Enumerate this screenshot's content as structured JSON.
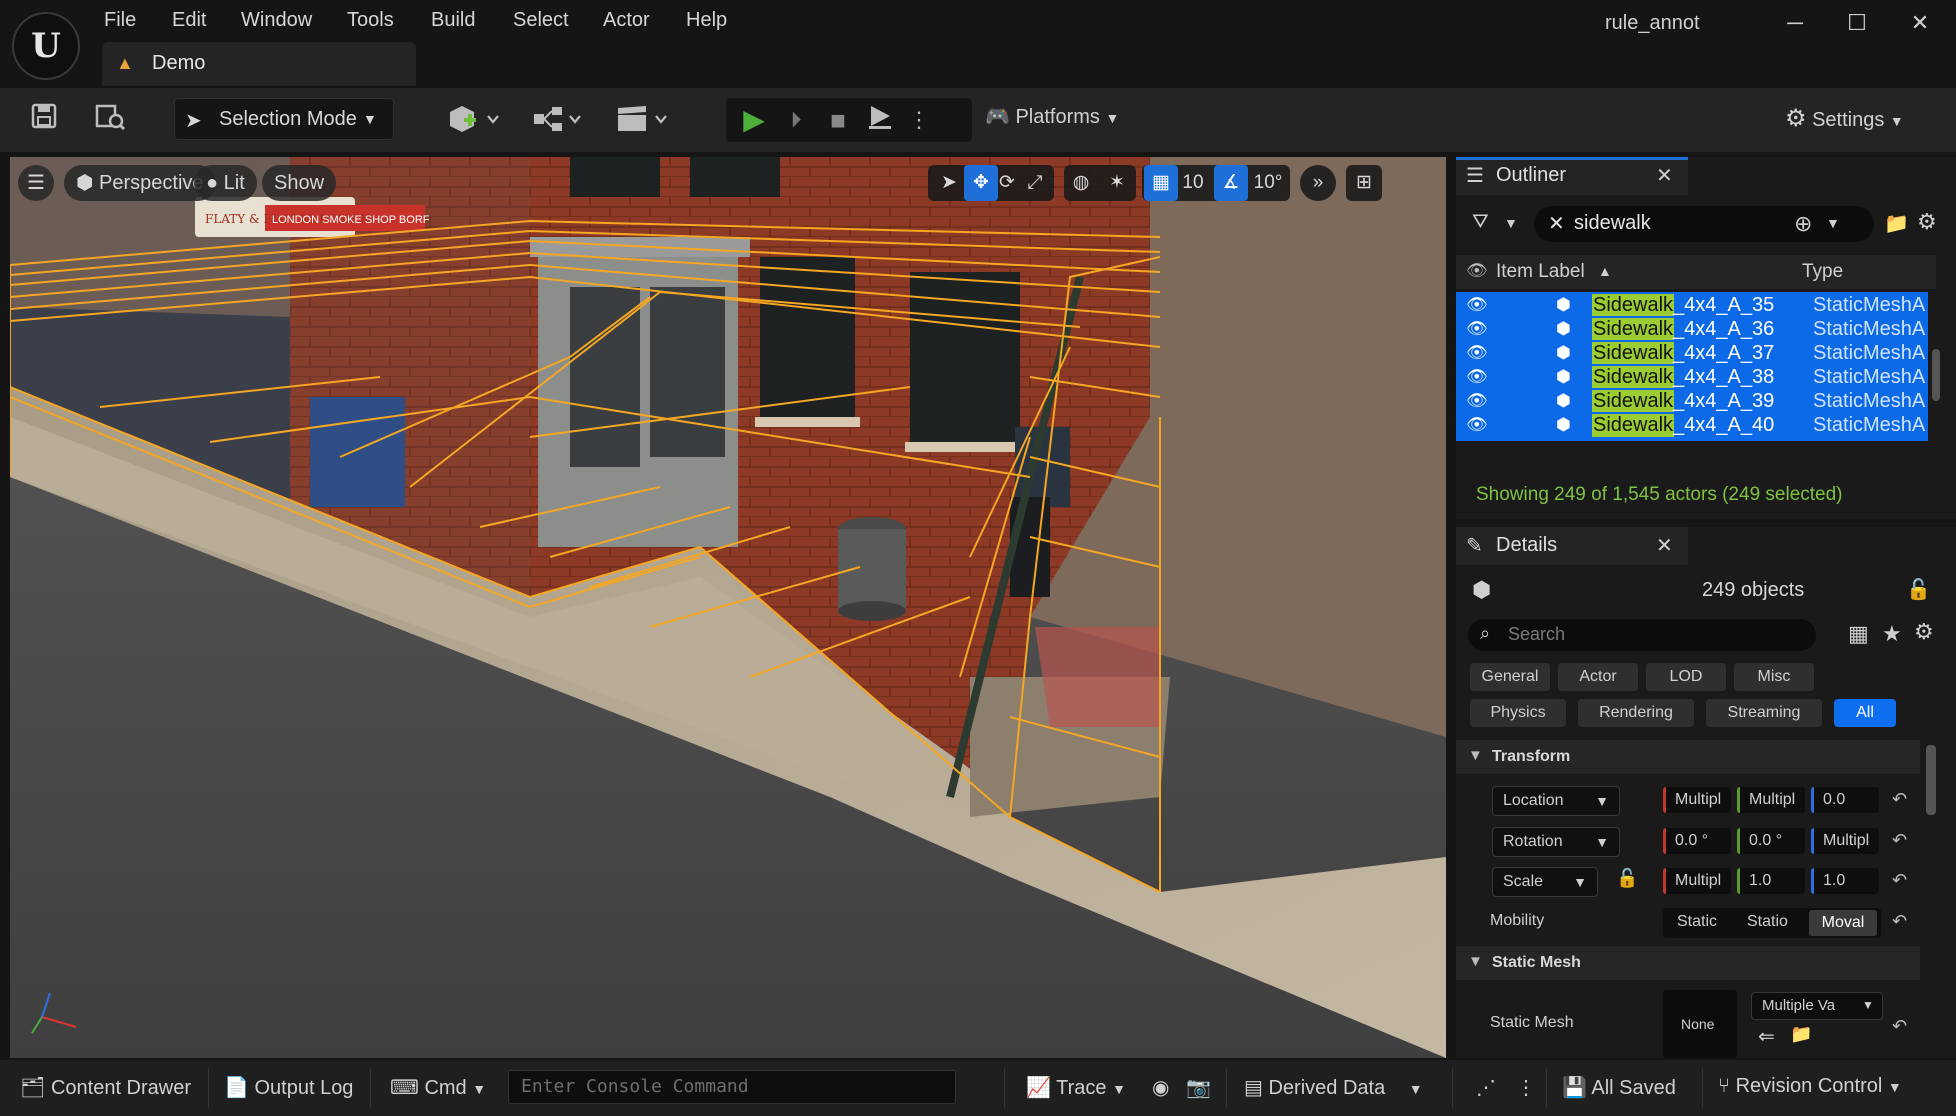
{
  "menu": [
    "File",
    "Edit",
    "Window",
    "Tools",
    "Build",
    "Select",
    "Actor",
    "Help"
  ],
  "project_tab": "Demo",
  "window_title": "rule_annot",
  "window_buttons": {
    "minimize": "─",
    "maximize": "☐",
    "close": "✕"
  },
  "toolbar": {
    "selection_mode": "Selection Mode",
    "platforms": "Platforms",
    "settings": "Settings"
  },
  "viewport": {
    "perspective": "Perspective",
    "lit": "Lit",
    "show": "Show",
    "grid_snap": "10",
    "rotation_snap": "10°",
    "signs": [
      "FLATY & FLORAL DESIGN",
      "LONDON SMOKE SHOP BORF"
    ]
  },
  "outliner": {
    "title": "Outliner",
    "search_value": "sidewalk",
    "col_label": "Item Label",
    "col_type": "Type",
    "highlight": "Sidewalk",
    "rows": [
      {
        "suffix": "_4x4_A_35",
        "type": "StaticMeshA"
      },
      {
        "suffix": "_4x4_A_36",
        "type": "StaticMeshA"
      },
      {
        "suffix": "_4x4_A_37",
        "type": "StaticMeshA"
      },
      {
        "suffix": "_4x4_A_38",
        "type": "StaticMeshA"
      },
      {
        "suffix": "_4x4_A_39",
        "type": "StaticMeshA"
      },
      {
        "suffix": "_4x4_A_40",
        "type": "StaticMeshA"
      }
    ],
    "status": "Showing 249 of 1,545 actors (249 selected)"
  },
  "details": {
    "title": "Details",
    "objects": "249 objects",
    "search_placeholder": "Search",
    "filters": [
      "General",
      "Actor",
      "LOD",
      "Misc",
      "Physics",
      "Rendering",
      "Streaming",
      "All"
    ],
    "transform": "Transform",
    "location": {
      "label": "Location",
      "x": "Multipl",
      "y": "Multipl",
      "z": "0.0"
    },
    "rotation": {
      "label": "Rotation",
      "x": "0.0 °",
      "y": "0.0 °",
      "z": "Multipl"
    },
    "scale": {
      "label": "Scale",
      "x": "Multipl",
      "y": "1.0",
      "z": "1.0"
    },
    "mobility": {
      "label": "Mobility",
      "options": [
        "Static",
        "Statio",
        "Moval"
      ]
    },
    "static_mesh_section": "Static Mesh",
    "static_mesh": {
      "label": "Static Mesh",
      "thumb": "None",
      "value": "Multiple Va"
    }
  },
  "statusbar": {
    "content_drawer": "Content Drawer",
    "output_log": "Output Log",
    "cmd": "Cmd",
    "console_placeholder": "Enter Console Command",
    "trace": "Trace",
    "derived_data": "Derived Data",
    "all_saved": "All Saved",
    "revision_control": "Revision Control"
  },
  "colors": {
    "accent": "#0e6ef0",
    "selection_outline": "#f5a623",
    "highlight": "#9acd32",
    "status_text": "#7fc241"
  }
}
